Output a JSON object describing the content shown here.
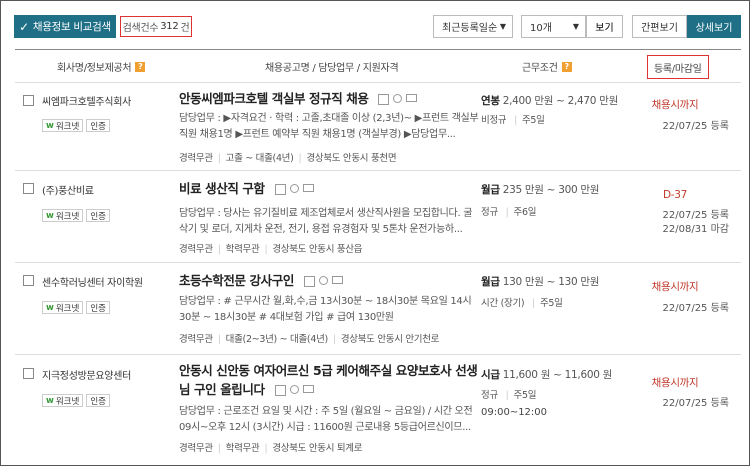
{
  "toolbar": {
    "compare_label": "채용정보 비교검색",
    "count_label": "검색건수",
    "count_value": "312",
    "count_unit": "건",
    "sort_value": "최근등록일순",
    "size_value": "10개",
    "view_label": "보기",
    "simple_label": "간편보기",
    "detail_label": "상세보기"
  },
  "header": {
    "company": "회사명/정보제공처",
    "title": "채용공고명 / 담당업무 / 지원자격",
    "conditions": "근무조건",
    "date": "등록/마감일"
  },
  "rows": [
    {
      "company": "씨엠파크호텔주식회사",
      "badge_worknet": "워크넷",
      "badge_cert": "인증",
      "title": "안동씨엠파크호텔 객실부 정규직 채용",
      "desc": "담당업무 : ▶자격요건 · 학력 : 고졸,초대졸 이상 (2,3년)~ ▶프런트 객실부 직원 채용1명 ▶프런트 예약부 직원 채용1명 (객실부경) ▶담당업무...",
      "tags": [
        "경력무관",
        "고졸 ~ 대졸(4년)",
        "경상북도 안동시 풍천면"
      ],
      "pay_type": "연봉",
      "pay": "2,400 만원 ~ 2,470 만원",
      "cond": [
        "비정규",
        "주5일"
      ],
      "cond3": "",
      "deadline": "채용시까지",
      "reg": "22/07/25 등록",
      "close": ""
    },
    {
      "company": "(주)풍산비료",
      "badge_worknet": "워크넷",
      "badge_cert": "인증",
      "title": "비료 생산직 구함",
      "desc": "담당업무 : 당사는 유기질비료 제조업체로서 생산직사원을 모집합니다. 굴삭기 및 로더, 지게차 운전, 전기, 용접 유경험자 및 5톤차 운전가능하...",
      "tags": [
        "경력무관",
        "학력무관",
        "경상북도 안동시 풍산읍"
      ],
      "pay_type": "월급",
      "pay": "235 만원 ~ 300 만원",
      "cond": [
        "정규",
        "주6일"
      ],
      "cond3": "",
      "deadline": "D-37",
      "reg": "22/07/25 등록",
      "close": "22/08/31 마감"
    },
    {
      "company": "센수학러닝센터 자이학원",
      "badge_worknet": "워크넷",
      "badge_cert": "인증",
      "title": "초등수학전문 강사구인",
      "desc": "담당업무 : # 근무시간 월,화,수,금 13시30분 ~ 18시30분 목요일 14시30분 ~ 18시30분 # 4대보험 가입 # 급여 130만원",
      "tags": [
        "경력무관",
        "대졸(2~3년) ~ 대졸(4년)",
        "경상북도 안동시 안기천로"
      ],
      "pay_type": "월급",
      "pay": "130 만원 ~ 130 만원",
      "cond": [
        "시간 (장기)",
        "주5일"
      ],
      "cond3": "",
      "deadline": "채용시까지",
      "reg": "22/07/25 등록",
      "close": ""
    },
    {
      "company": "지극정성방문요양센터",
      "badge_worknet": "워크넷",
      "badge_cert": "인증",
      "title": "안동시 신안동 여자어르신 5급 케어해주실 요양보호사 선생님 구인 올립니다",
      "desc": "담당업무 : 근로조건 요일 및 시간 : 주 5일 (월요일 ~ 금요일) / 시간 오전 09시~오후 12시 (3시간) 시급 : 11600원 근로내용 5등급어르신이므...",
      "tags": [
        "경력무관",
        "학력무관",
        "경상북도 안동시 퇴계로"
      ],
      "pay_type": "시급",
      "pay": "11,600 원 ~ 11,600 원",
      "cond": [
        "정규",
        "주5일"
      ],
      "cond3": "09:00~12:00",
      "deadline": "채용시까지",
      "reg": "22/07/25 등록",
      "close": ""
    }
  ]
}
